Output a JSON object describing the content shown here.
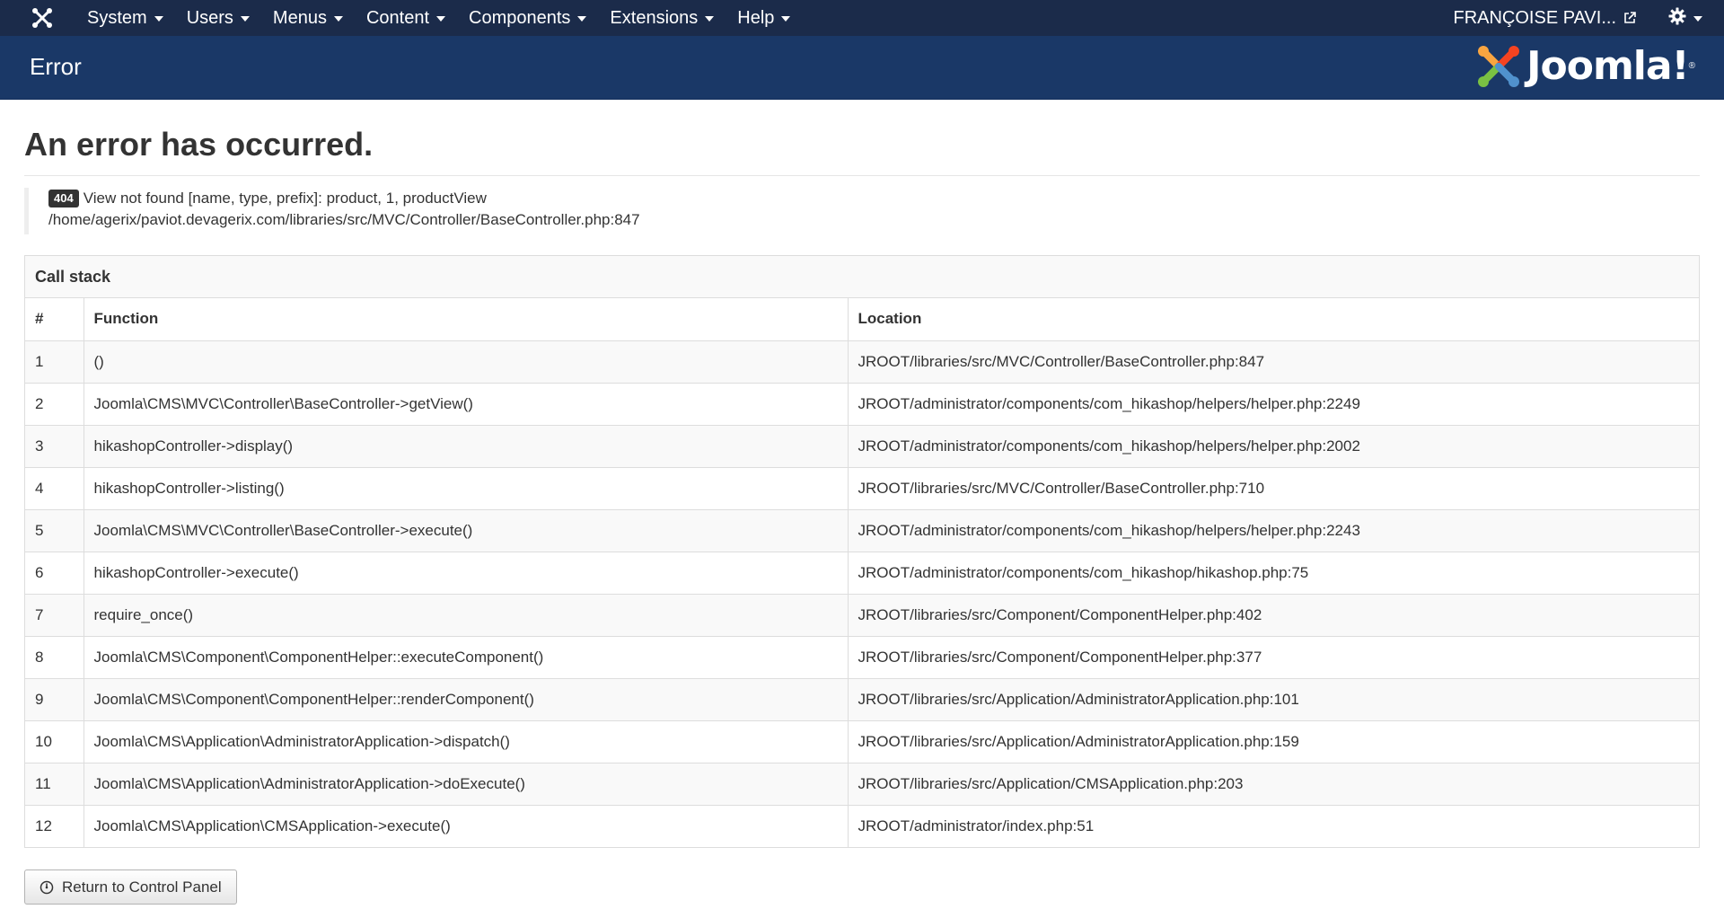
{
  "navbar": {
    "menu": [
      {
        "label": "System"
      },
      {
        "label": "Users"
      },
      {
        "label": "Menus"
      },
      {
        "label": "Content"
      },
      {
        "label": "Components"
      },
      {
        "label": "Extensions"
      },
      {
        "label": "Help"
      }
    ],
    "user": "FRANÇOISE PAVI...",
    "icons": {
      "brand": "joomla-icon",
      "external": "external-link-icon",
      "settings": "gear-icon"
    }
  },
  "header": {
    "title": "Error",
    "logo_text": "Joomla!",
    "logo_reg": "®"
  },
  "error": {
    "heading": "An error has occurred.",
    "code": "404",
    "message": "View not found [name, type, prefix]: product, 1, productView",
    "path": "/home/agerix/paviot.devagerix.com/libraries/src/MVC/Controller/BaseController.php:847"
  },
  "callstack": {
    "caption": "Call stack",
    "columns": [
      "#",
      "Function",
      "Location"
    ],
    "rows": [
      {
        "num": "1",
        "function": "()",
        "location": "JROOT/libraries/src/MVC/Controller/BaseController.php:847"
      },
      {
        "num": "2",
        "function": "Joomla\\CMS\\MVC\\Controller\\BaseController->getView()",
        "location": "JROOT/administrator/components/com_hikashop/helpers/helper.php:2249"
      },
      {
        "num": "3",
        "function": "hikashopController->display()",
        "location": "JROOT/administrator/components/com_hikashop/helpers/helper.php:2002"
      },
      {
        "num": "4",
        "function": "hikashopController->listing()",
        "location": "JROOT/libraries/src/MVC/Controller/BaseController.php:710"
      },
      {
        "num": "5",
        "function": "Joomla\\CMS\\MVC\\Controller\\BaseController->execute()",
        "location": "JROOT/administrator/components/com_hikashop/helpers/helper.php:2243"
      },
      {
        "num": "6",
        "function": "hikashopController->execute()",
        "location": "JROOT/administrator/components/com_hikashop/hikashop.php:75"
      },
      {
        "num": "7",
        "function": "require_once()",
        "location": "JROOT/libraries/src/Component/ComponentHelper.php:402"
      },
      {
        "num": "8",
        "function": "Joomla\\CMS\\Component\\ComponentHelper::executeComponent()",
        "location": "JROOT/libraries/src/Component/ComponentHelper.php:377"
      },
      {
        "num": "9",
        "function": "Joomla\\CMS\\Component\\ComponentHelper::renderComponent()",
        "location": "JROOT/libraries/src/Application/AdministratorApplication.php:101"
      },
      {
        "num": "10",
        "function": "Joomla\\CMS\\Application\\AdministratorApplication->dispatch()",
        "location": "JROOT/libraries/src/Application/AdministratorApplication.php:159"
      },
      {
        "num": "11",
        "function": "Joomla\\CMS\\Application\\AdministratorApplication->doExecute()",
        "location": "JROOT/libraries/src/Application/CMSApplication.php:203"
      },
      {
        "num": "12",
        "function": "Joomla\\CMS\\Application\\CMSApplication->execute()",
        "location": "JROOT/administrator/index.php:51"
      }
    ]
  },
  "return_button": {
    "label": "Return to Control Panel",
    "icon": "dashboard-icon"
  },
  "colors": {
    "navbar": "#1b2b4a",
    "subheader": "#1a3867",
    "badge": "#333333"
  }
}
